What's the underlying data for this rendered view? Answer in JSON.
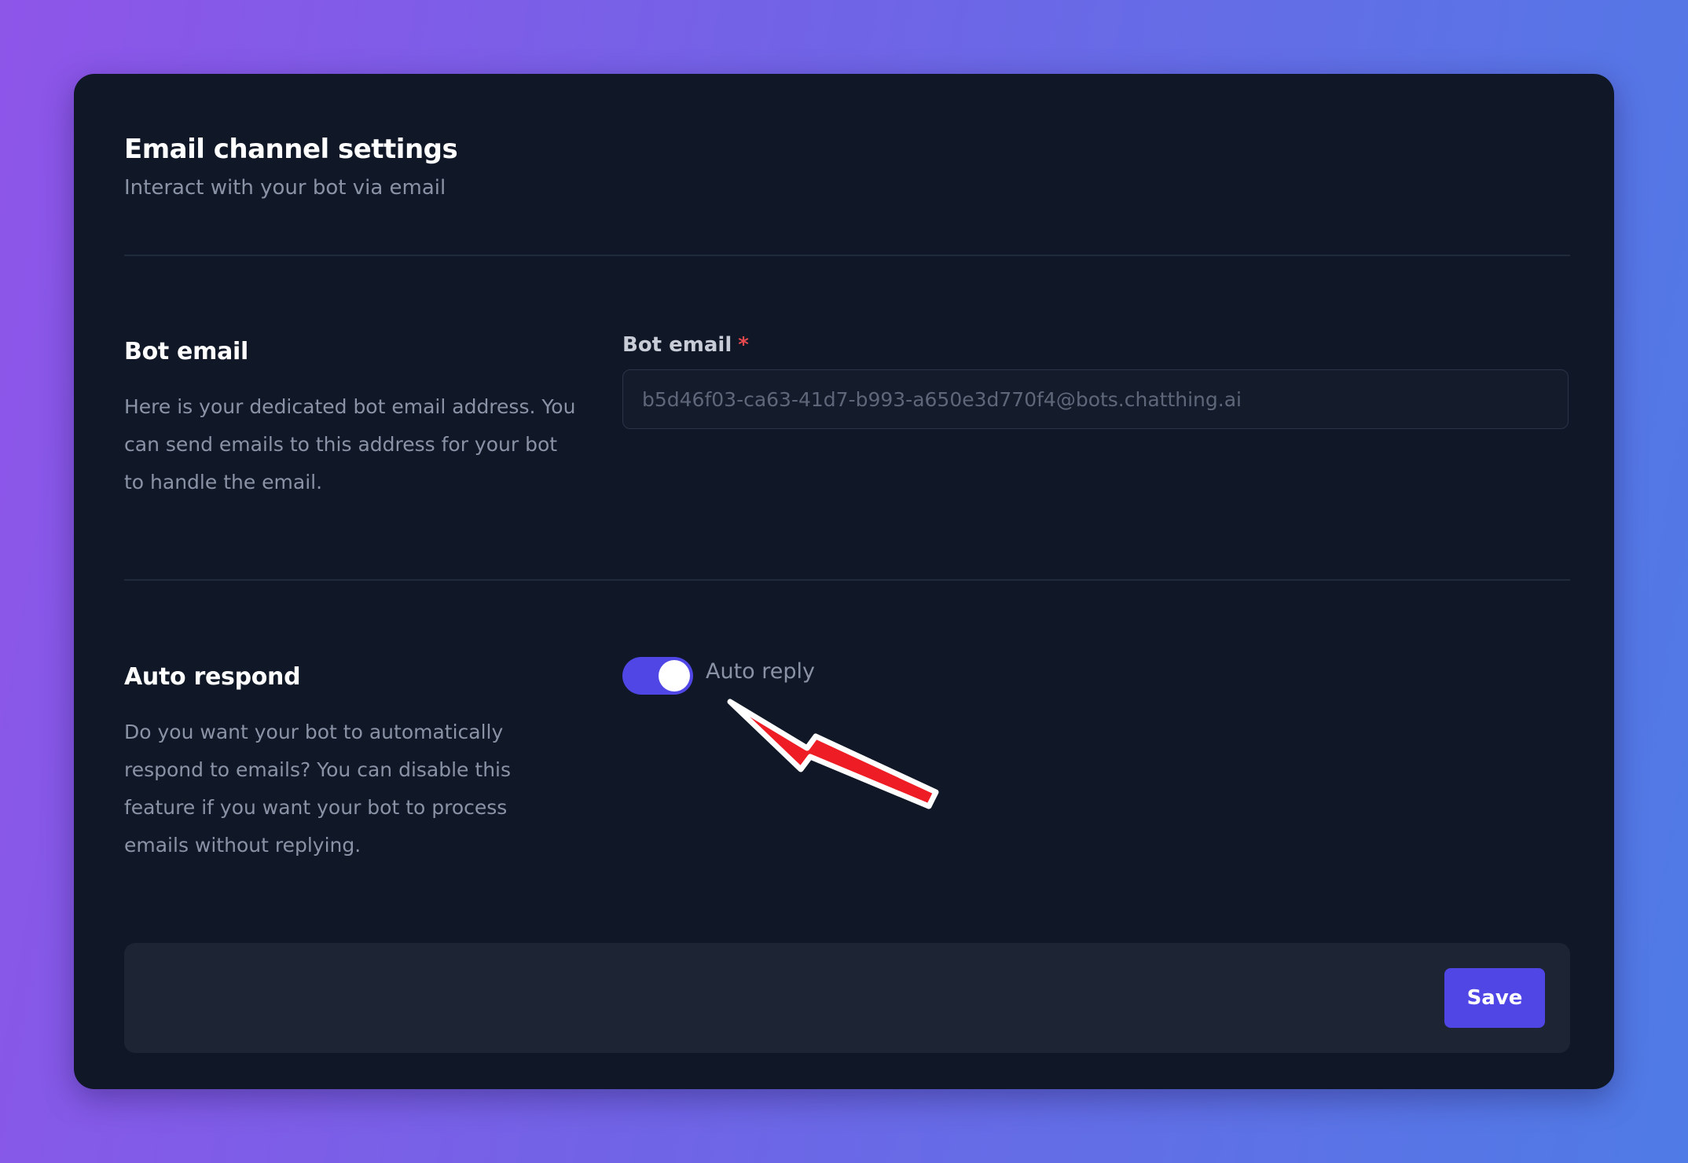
{
  "header": {
    "title": "Email channel settings",
    "subtitle": "Interact with your bot via email"
  },
  "bot_email": {
    "section_title": "Bot email",
    "description": "Here is your dedicated bot email address. You can send emails to this address for your bot to handle the email.",
    "field_label": "Bot email",
    "required_mark": "*",
    "value": "b5d46f03-ca63-41d7-b993-a650e3d770f4@bots.chatthing.ai"
  },
  "auto_respond": {
    "section_title": "Auto respond",
    "description": "Do you want your bot to automatically respond to emails? You can disable this feature if you want your bot to process emails without replying.",
    "toggle_label": "Auto reply",
    "toggle_state": "on"
  },
  "footer": {
    "save_label": "Save"
  },
  "colors": {
    "accent": "#4f46e5",
    "card_background": "#101828",
    "annotation_arrow": "#ee1c24"
  },
  "annotation": {
    "icon": "red-arrow-icon",
    "points_to": "auto-reply-toggle"
  }
}
